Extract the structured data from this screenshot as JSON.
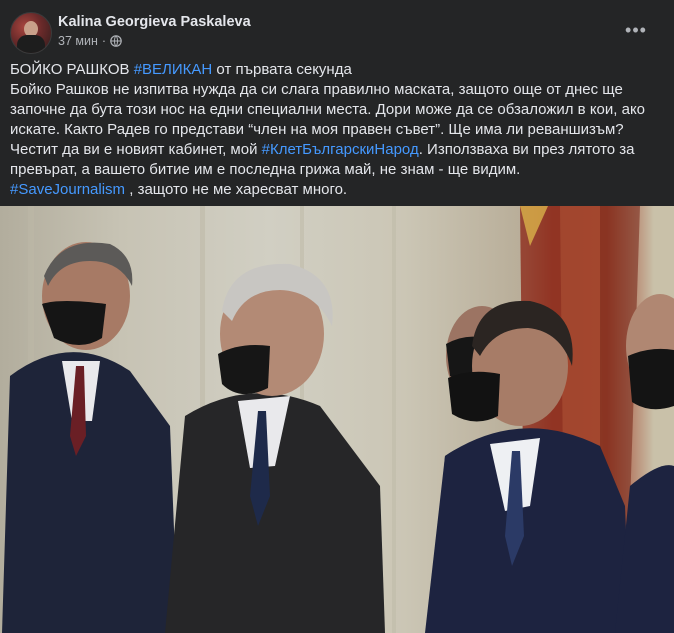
{
  "post": {
    "author": "Kalina Georgieva Paskaleva",
    "time": "37 мин",
    "separator": "·",
    "privacy_icon": "globe-icon",
    "more_icon": "more-horizontal-icon",
    "text": {
      "line1_prefix": "БОЙКО РАШКОВ ",
      "line1_hashtag": "#ВЕЛИКАН",
      "line1_suffix": " от първата секунда",
      "line2": "Бойко Рашков не изпитва нужда да си слага правилно маската, защото още от днес ще",
      "line3": "започне да бута този нос на едни специални места. Дори може да се обзаложил в кои, ако",
      "line4": "искате. Както Радев го представи “член на моя правен съвет”. Ще има ли реваншизъм?",
      "line5_prefix": "Честит да ви е новият кабинет, мой ",
      "line5_hashtag": "#КлетБългарскиНарод",
      "line5_suffix": ". Използваха ви през лятото за",
      "line6": "превърат, а вашето битие им е последна грижа май, не знам - ще видим.",
      "line7_hashtag": "#SaveJournalism",
      "line7_suffix": " , защото не ме харесват много."
    }
  },
  "colors": {
    "background": "#242526",
    "text": "#e4e6eb",
    "secondary_text": "#b0b3b8",
    "hashtag": "#4599ff"
  }
}
